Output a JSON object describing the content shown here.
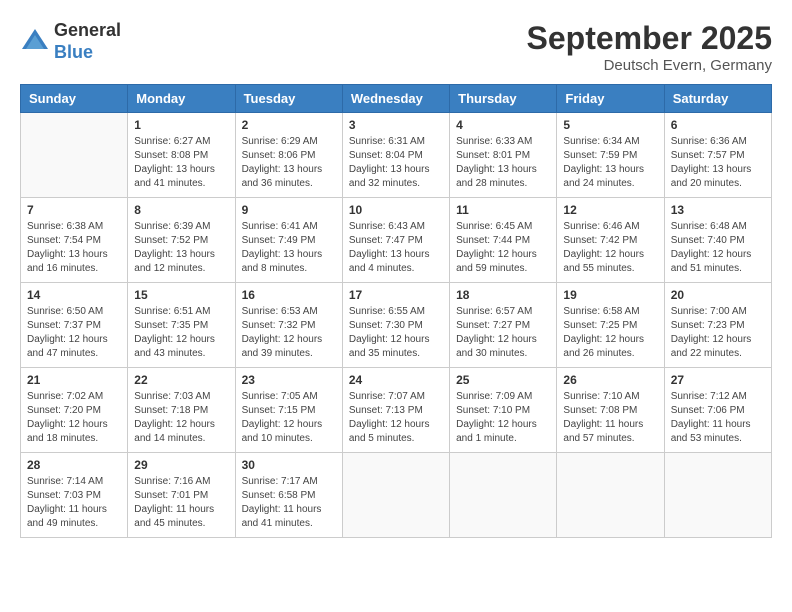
{
  "header": {
    "logo_general": "General",
    "logo_blue": "Blue",
    "month": "September 2025",
    "location": "Deutsch Evern, Germany"
  },
  "days_of_week": [
    "Sunday",
    "Monday",
    "Tuesday",
    "Wednesday",
    "Thursday",
    "Friday",
    "Saturday"
  ],
  "weeks": [
    [
      {
        "day": "",
        "text": ""
      },
      {
        "day": "1",
        "text": "Sunrise: 6:27 AM\nSunset: 8:08 PM\nDaylight: 13 hours\nand 41 minutes."
      },
      {
        "day": "2",
        "text": "Sunrise: 6:29 AM\nSunset: 8:06 PM\nDaylight: 13 hours\nand 36 minutes."
      },
      {
        "day": "3",
        "text": "Sunrise: 6:31 AM\nSunset: 8:04 PM\nDaylight: 13 hours\nand 32 minutes."
      },
      {
        "day": "4",
        "text": "Sunrise: 6:33 AM\nSunset: 8:01 PM\nDaylight: 13 hours\nand 28 minutes."
      },
      {
        "day": "5",
        "text": "Sunrise: 6:34 AM\nSunset: 7:59 PM\nDaylight: 13 hours\nand 24 minutes."
      },
      {
        "day": "6",
        "text": "Sunrise: 6:36 AM\nSunset: 7:57 PM\nDaylight: 13 hours\nand 20 minutes."
      }
    ],
    [
      {
        "day": "7",
        "text": "Sunrise: 6:38 AM\nSunset: 7:54 PM\nDaylight: 13 hours\nand 16 minutes."
      },
      {
        "day": "8",
        "text": "Sunrise: 6:39 AM\nSunset: 7:52 PM\nDaylight: 13 hours\nand 12 minutes."
      },
      {
        "day": "9",
        "text": "Sunrise: 6:41 AM\nSunset: 7:49 PM\nDaylight: 13 hours\nand 8 minutes."
      },
      {
        "day": "10",
        "text": "Sunrise: 6:43 AM\nSunset: 7:47 PM\nDaylight: 13 hours\nand 4 minutes."
      },
      {
        "day": "11",
        "text": "Sunrise: 6:45 AM\nSunset: 7:44 PM\nDaylight: 12 hours\nand 59 minutes."
      },
      {
        "day": "12",
        "text": "Sunrise: 6:46 AM\nSunset: 7:42 PM\nDaylight: 12 hours\nand 55 minutes."
      },
      {
        "day": "13",
        "text": "Sunrise: 6:48 AM\nSunset: 7:40 PM\nDaylight: 12 hours\nand 51 minutes."
      }
    ],
    [
      {
        "day": "14",
        "text": "Sunrise: 6:50 AM\nSunset: 7:37 PM\nDaylight: 12 hours\nand 47 minutes."
      },
      {
        "day": "15",
        "text": "Sunrise: 6:51 AM\nSunset: 7:35 PM\nDaylight: 12 hours\nand 43 minutes."
      },
      {
        "day": "16",
        "text": "Sunrise: 6:53 AM\nSunset: 7:32 PM\nDaylight: 12 hours\nand 39 minutes."
      },
      {
        "day": "17",
        "text": "Sunrise: 6:55 AM\nSunset: 7:30 PM\nDaylight: 12 hours\nand 35 minutes."
      },
      {
        "day": "18",
        "text": "Sunrise: 6:57 AM\nSunset: 7:27 PM\nDaylight: 12 hours\nand 30 minutes."
      },
      {
        "day": "19",
        "text": "Sunrise: 6:58 AM\nSunset: 7:25 PM\nDaylight: 12 hours\nand 26 minutes."
      },
      {
        "day": "20",
        "text": "Sunrise: 7:00 AM\nSunset: 7:23 PM\nDaylight: 12 hours\nand 22 minutes."
      }
    ],
    [
      {
        "day": "21",
        "text": "Sunrise: 7:02 AM\nSunset: 7:20 PM\nDaylight: 12 hours\nand 18 minutes."
      },
      {
        "day": "22",
        "text": "Sunrise: 7:03 AM\nSunset: 7:18 PM\nDaylight: 12 hours\nand 14 minutes."
      },
      {
        "day": "23",
        "text": "Sunrise: 7:05 AM\nSunset: 7:15 PM\nDaylight: 12 hours\nand 10 minutes."
      },
      {
        "day": "24",
        "text": "Sunrise: 7:07 AM\nSunset: 7:13 PM\nDaylight: 12 hours\nand 5 minutes."
      },
      {
        "day": "25",
        "text": "Sunrise: 7:09 AM\nSunset: 7:10 PM\nDaylight: 12 hours\nand 1 minute."
      },
      {
        "day": "26",
        "text": "Sunrise: 7:10 AM\nSunset: 7:08 PM\nDaylight: 11 hours\nand 57 minutes."
      },
      {
        "day": "27",
        "text": "Sunrise: 7:12 AM\nSunset: 7:06 PM\nDaylight: 11 hours\nand 53 minutes."
      }
    ],
    [
      {
        "day": "28",
        "text": "Sunrise: 7:14 AM\nSunset: 7:03 PM\nDaylight: 11 hours\nand 49 minutes."
      },
      {
        "day": "29",
        "text": "Sunrise: 7:16 AM\nSunset: 7:01 PM\nDaylight: 11 hours\nand 45 minutes."
      },
      {
        "day": "30",
        "text": "Sunrise: 7:17 AM\nSunset: 6:58 PM\nDaylight: 11 hours\nand 41 minutes."
      },
      {
        "day": "",
        "text": ""
      },
      {
        "day": "",
        "text": ""
      },
      {
        "day": "",
        "text": ""
      },
      {
        "day": "",
        "text": ""
      }
    ]
  ]
}
